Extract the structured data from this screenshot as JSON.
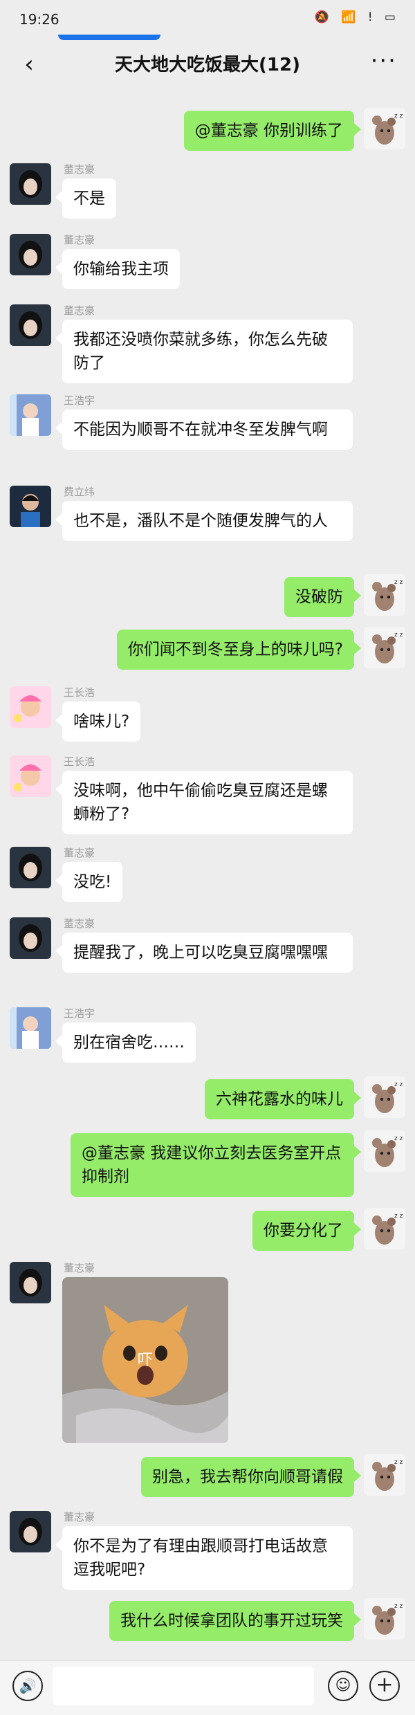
{
  "status_bar": {
    "time": "19:26",
    "icons": "🔕 📶 ! ▭"
  },
  "header": {
    "back_icon": "‹",
    "title": "天大地大吃饭最大(12)",
    "more_icon": "···"
  },
  "messages": [
    {
      "side": "out",
      "text": "@董志豪 你别训练了"
    },
    {
      "side": "in",
      "sender": "董志豪",
      "text": "不是"
    },
    {
      "side": "in",
      "sender": "董志豪",
      "text": "你输给我主项"
    },
    {
      "side": "in",
      "sender": "董志豪",
      "text": "我都还没喷你菜就多练，你怎么先破防了"
    },
    {
      "side": "in",
      "sender": "王浩宇",
      "text": "不能因为顺哥不在就冲冬至发脾气啊"
    },
    {
      "side": "in",
      "sender": "费立纬",
      "text": "也不是，潘队不是个随便发脾气的人"
    },
    {
      "side": "out",
      "text": "没破防"
    },
    {
      "side": "out",
      "text": "你们闻不到冬至身上的味儿吗?"
    },
    {
      "side": "in",
      "sender": "王长浩",
      "text": "啥味儿?"
    },
    {
      "side": "in",
      "sender": "王长浩",
      "text": "没味啊，他中午偷偷吃臭豆腐还是螺蛳粉了?"
    },
    {
      "side": "in",
      "sender": "董志豪",
      "text": "没吃!"
    },
    {
      "side": "in",
      "sender": "董志豪",
      "text": "提醒我了，晚上可以吃臭豆腐嘿嘿嘿"
    },
    {
      "side": "in",
      "sender": "王浩宇",
      "text": "别在宿舍吃……"
    },
    {
      "side": "out",
      "text": "六神花露水的味儿"
    },
    {
      "side": "out",
      "text": "@董志豪 我建议你立刻去医务室开点抑制剂"
    },
    {
      "side": "out",
      "text": "你要分化了"
    },
    {
      "side": "in",
      "sender": "董志豪",
      "sticker_caption": "吓"
    },
    {
      "side": "out",
      "text": "别急，我去帮你向顺哥请假"
    },
    {
      "side": "in",
      "sender": "董志豪",
      "text": "你不是为了有理由跟顺哥打电话故意逗我呢吧?"
    },
    {
      "side": "out",
      "text": "我什么时候拿团队的事开过玩笑"
    }
  ],
  "bottom_bar": {
    "voice_icon": "🔊",
    "emoji_icon": "☺",
    "plus_icon": "+"
  },
  "colors": {
    "background": "#ededed",
    "outgoing": "#95ec69",
    "incoming": "#ffffff"
  }
}
